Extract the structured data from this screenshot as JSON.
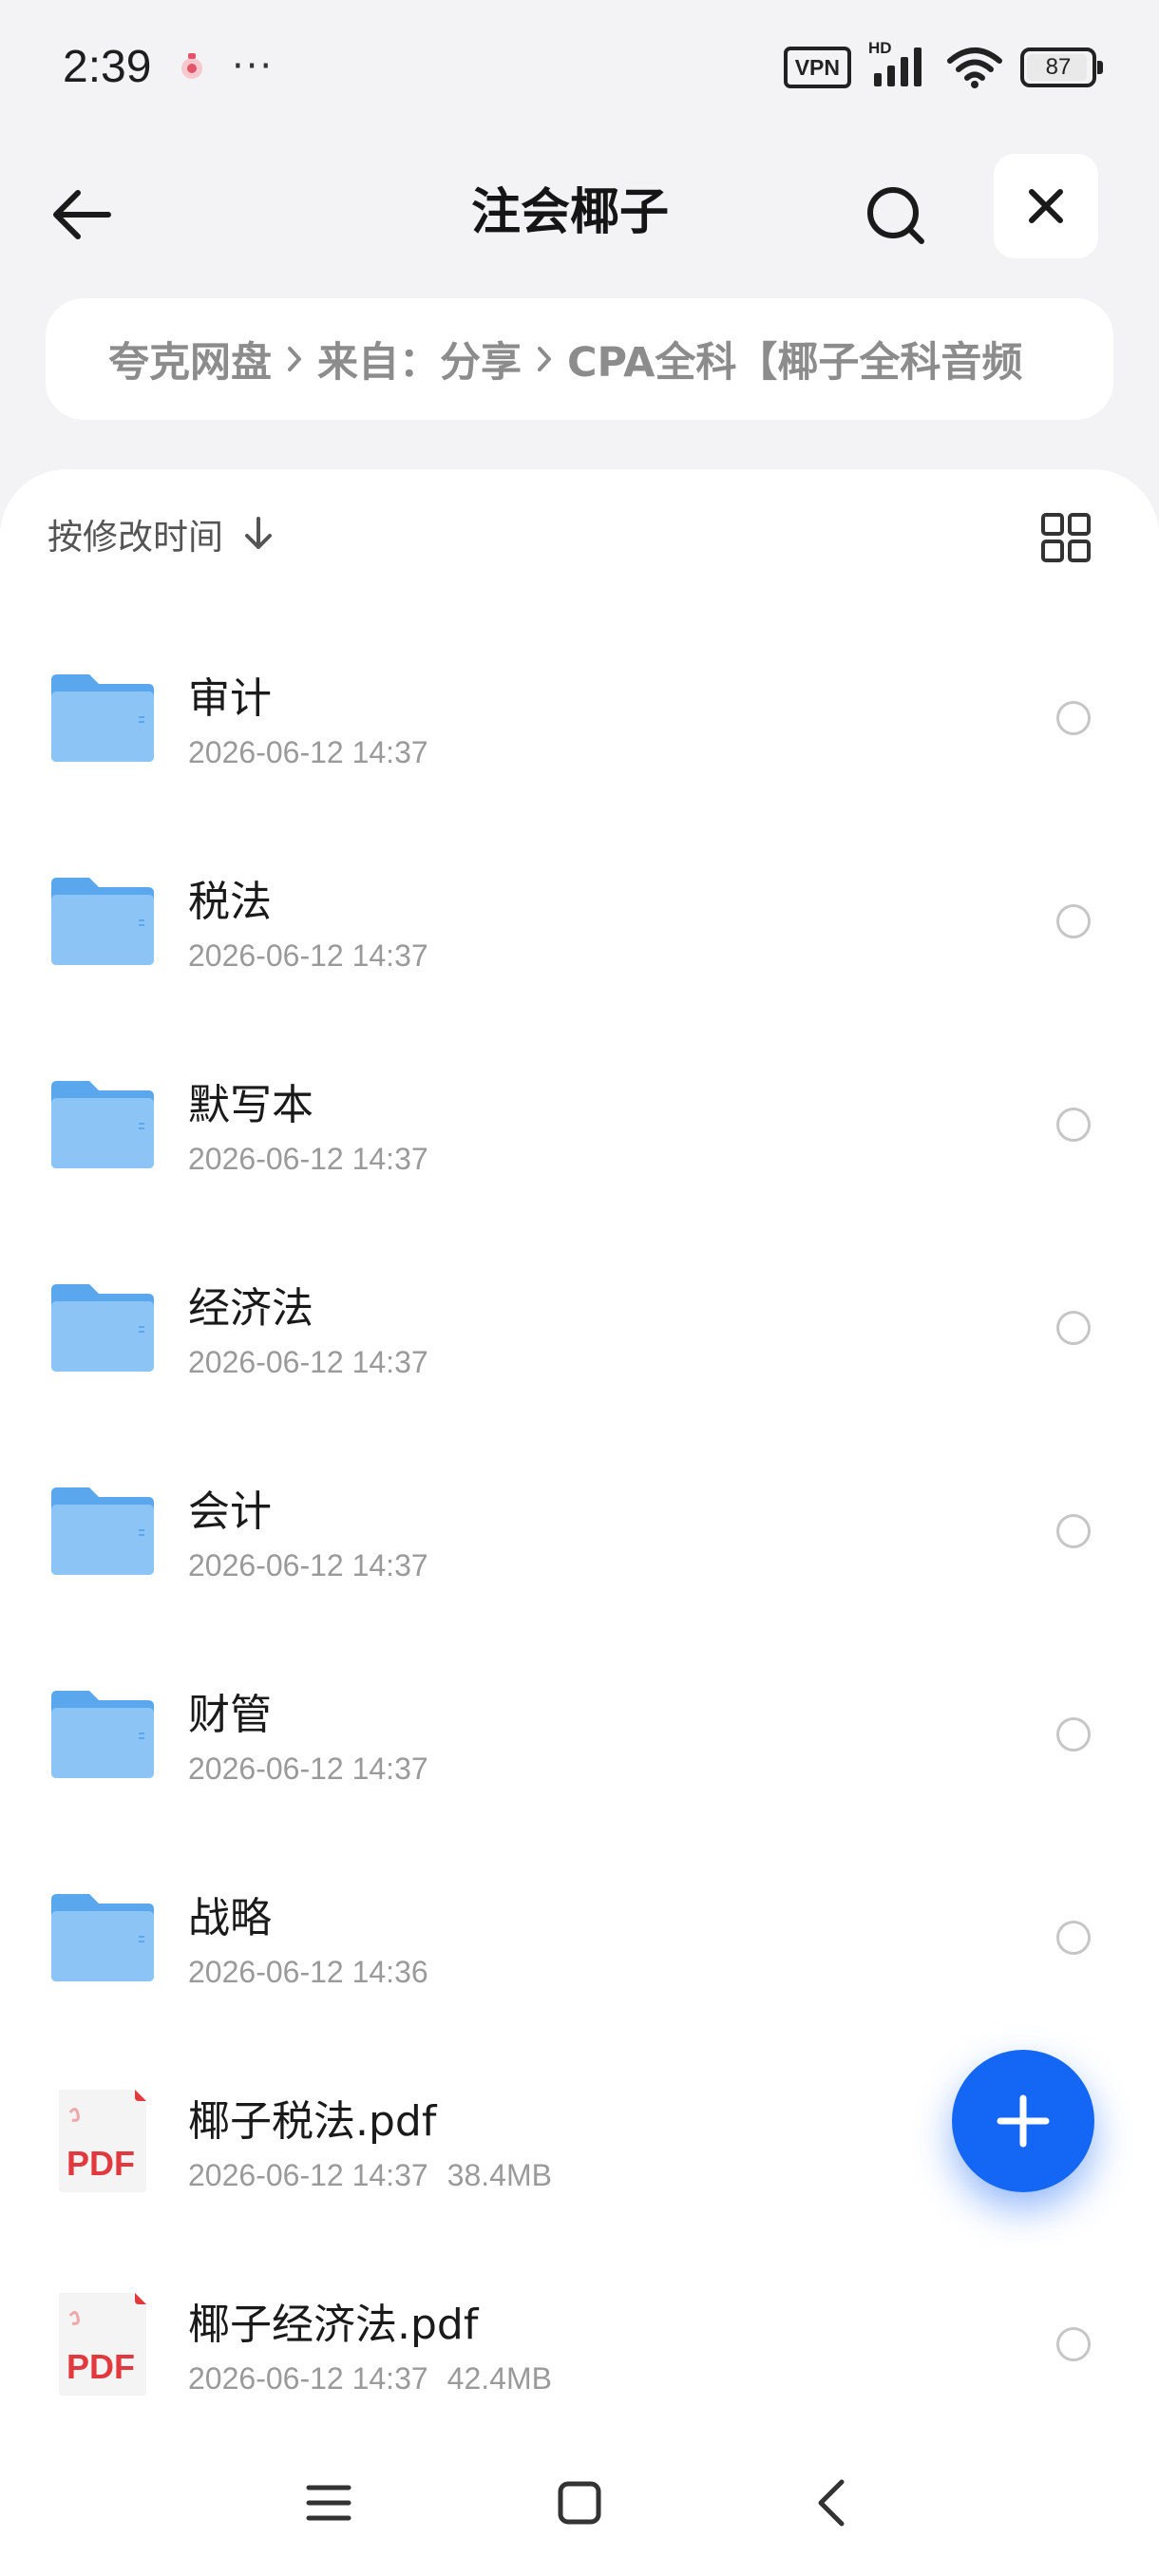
{
  "status_bar": {
    "time": "2:39",
    "more": "···",
    "vpn_label": "VPN",
    "network_label": "HD",
    "battery_level": "87"
  },
  "header": {
    "title": "注会椰子"
  },
  "breadcrumb": {
    "items": [
      "夸克网盘",
      "来自：分享",
      "CPA全科【椰子全科音频"
    ]
  },
  "toolbar": {
    "sort_label": "按修改时间"
  },
  "files": [
    {
      "name": "审计",
      "modified": "2026-06-12 14:37",
      "type": "folder"
    },
    {
      "name": "税法",
      "modified": "2026-06-12 14:37",
      "type": "folder"
    },
    {
      "name": "默写本",
      "modified": "2026-06-12 14:37",
      "type": "folder"
    },
    {
      "name": "经济法",
      "modified": "2026-06-12 14:37",
      "type": "folder"
    },
    {
      "name": "会计",
      "modified": "2026-06-12 14:37",
      "type": "folder"
    },
    {
      "name": "财管",
      "modified": "2026-06-12 14:37",
      "type": "folder"
    },
    {
      "name": "战略",
      "modified": "2026-06-12 14:36",
      "type": "folder"
    },
    {
      "name": "椰子税法.pdf",
      "modified": "2026-06-12 14:37",
      "size": "38.4MB",
      "type": "pdf",
      "badge": "PDF"
    },
    {
      "name": "椰子经济法.pdf",
      "modified": "2026-06-12 14:37",
      "size": "42.4MB",
      "type": "pdf",
      "badge": "PDF"
    }
  ],
  "colors": {
    "accent": "#1467f5",
    "folder": "#5aa7ee",
    "pdf_red": "#e1393d",
    "background": "#f3f3f5"
  }
}
